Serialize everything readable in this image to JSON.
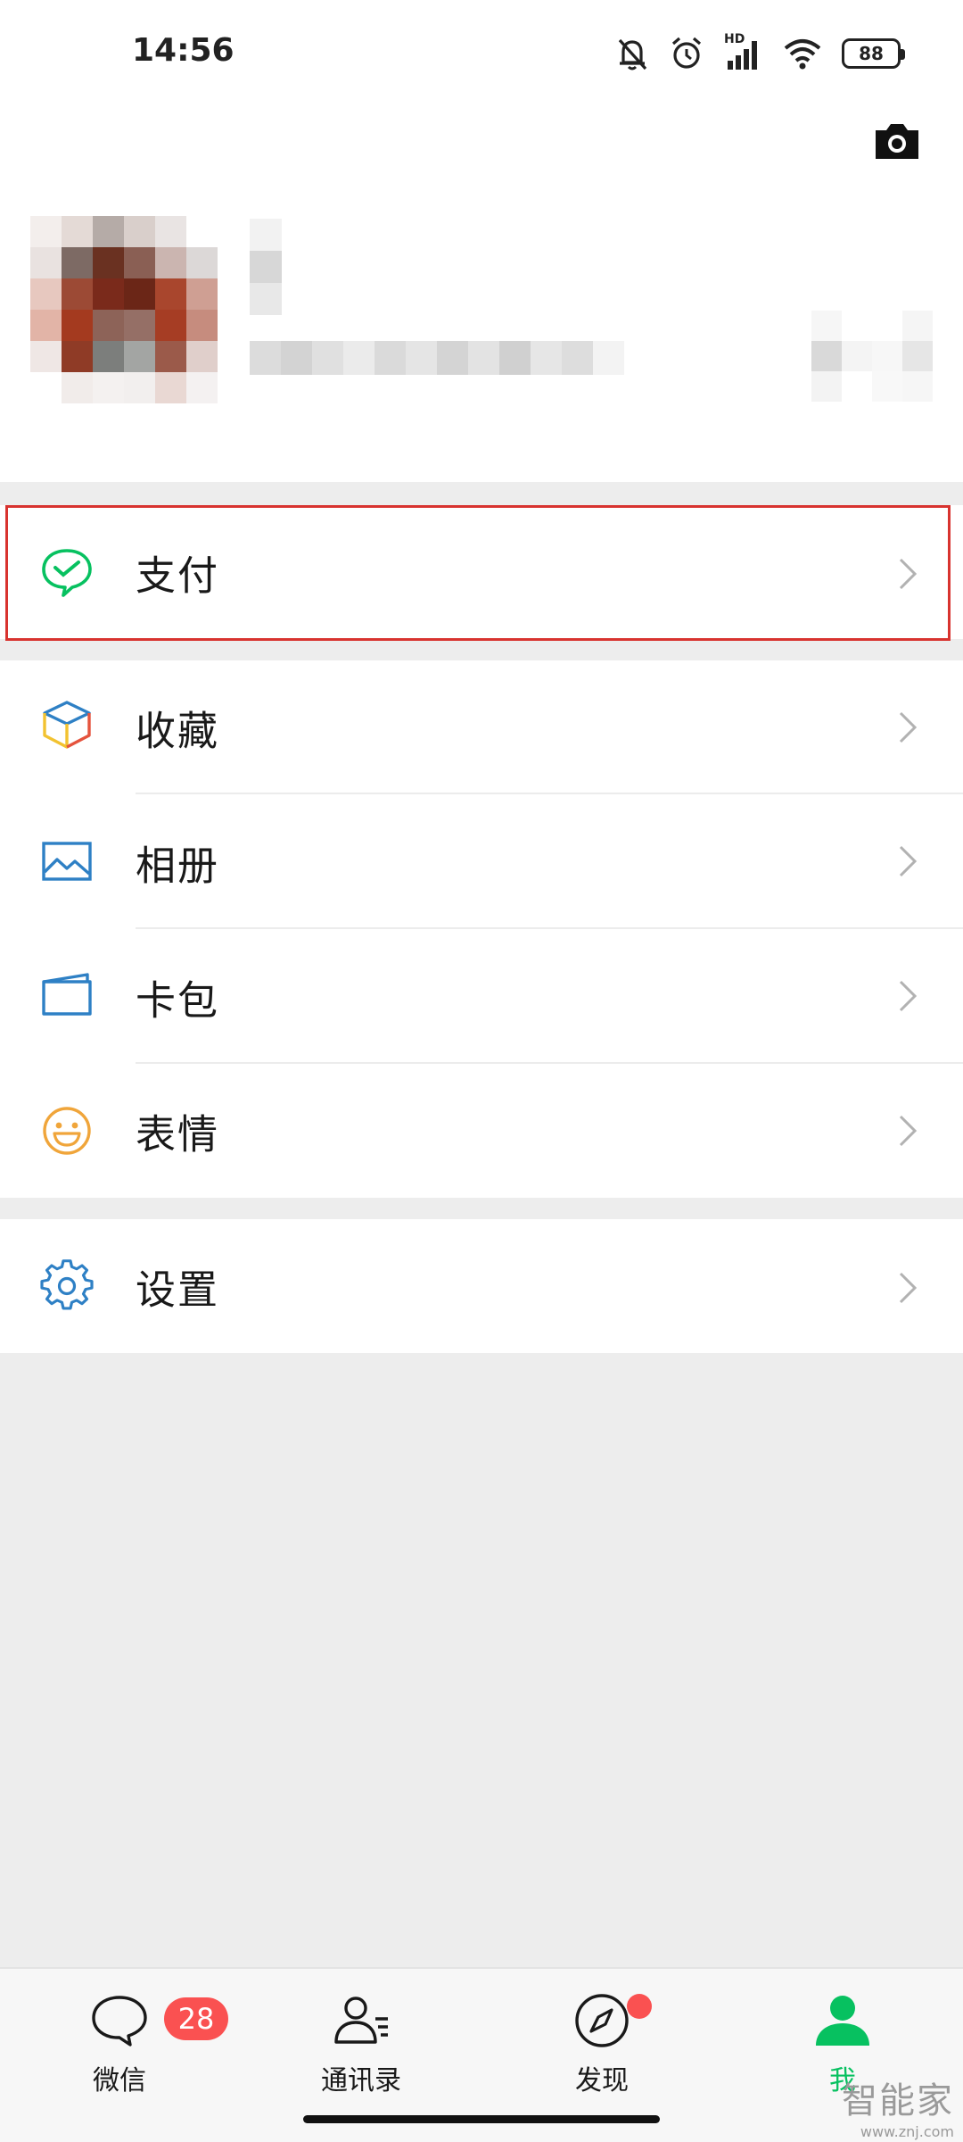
{
  "status_bar": {
    "time": "14:56",
    "network": "HD",
    "battery": "88",
    "icons": [
      "mute-bell-icon",
      "alarm-icon",
      "signal-icon",
      "wifi-icon",
      "battery-icon"
    ]
  },
  "profile": {
    "camera_icon": "camera-icon",
    "avatar": "blurred",
    "nickname": "blurred",
    "wechat_id": "blurred"
  },
  "menu": {
    "pay": {
      "label": "支付",
      "icon": "wechat-pay-icon",
      "color": "#07c160",
      "highlighted": true
    },
    "group2": [
      {
        "key": "favorites",
        "label": "收藏",
        "icon": "cube-icon"
      },
      {
        "key": "album",
        "label": "相册",
        "icon": "photo-icon",
        "color": "#2e80c5"
      },
      {
        "key": "cards",
        "label": "卡包",
        "icon": "card-wallet-icon",
        "color": "#2e80c5"
      },
      {
        "key": "stickers",
        "label": "表情",
        "icon": "smiley-icon",
        "color": "#f0a53a"
      }
    ],
    "settings": {
      "label": "设置",
      "icon": "gear-icon",
      "color": "#2e80c5"
    }
  },
  "tabbar": {
    "tabs": [
      {
        "key": "chats",
        "label": "微信",
        "icon": "chat-bubble-icon",
        "badge": "28"
      },
      {
        "key": "contacts",
        "label": "通讯录",
        "icon": "contacts-icon"
      },
      {
        "key": "discover",
        "label": "发现",
        "icon": "compass-icon",
        "dot": true
      },
      {
        "key": "me",
        "label": "我",
        "icon": "person-icon",
        "active": true
      }
    ],
    "active_color": "#07c160",
    "badge_color": "#fa5151"
  },
  "watermark": {
    "title": "智能家",
    "url": "www.znj.com"
  },
  "colors": {
    "highlight_border": "#d8332f",
    "background": "#ededed"
  }
}
